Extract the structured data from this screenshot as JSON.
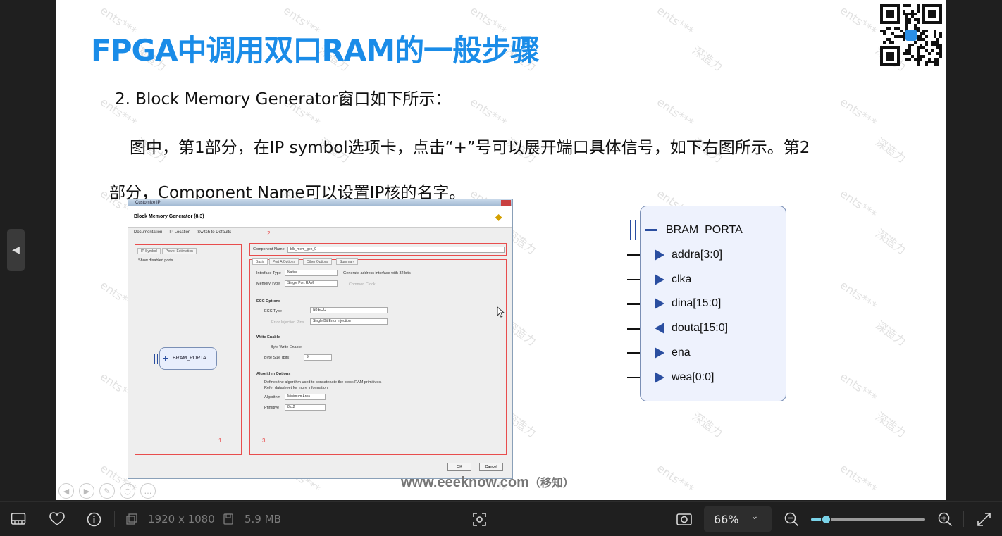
{
  "slide": {
    "title": "FPGA中调用双口RAM的一般步骤",
    "line1": "2.  Block Memory Generator窗口如下所示：",
    "line2": "图中，第1部分，在IP symbol选项卡，点击“+”号可以展开端口具体信号，如下右图所示。第2",
    "line3": "部分，Component Name可以设置IP核的名字。",
    "footer_url": "www.eeeknow.com",
    "footer_cn": "（移知）",
    "watermark_a": "ents***",
    "watermark_b": "深造力"
  },
  "ip_window": {
    "titlebar": "Customize IP",
    "header": "Block Memory Generator (8.3)",
    "toolbar": [
      "Documentation",
      "IP Location",
      "Switch to Defaults"
    ],
    "left_tabs": [
      "IP Symbol",
      "Power Estimation"
    ],
    "show_disabled": "Show disabled ports",
    "port_label": "BRAM_PORTA",
    "component_name_label": "Component Name",
    "component_name_value": "blk_mem_gen_0",
    "right_tabs": [
      "Basic",
      "Port A Options",
      "Other Options",
      "Summary"
    ],
    "interface_type_label": "Interface Type",
    "interface_type_value": "Native",
    "generate_addr": "Generate address interface with 32 bits",
    "memory_type_label": "Memory Type",
    "memory_type_value": "Single Port RAM",
    "common_clock": "Common Clock",
    "ecc_section": "ECC Options",
    "ecc_type_label": "ECC Type",
    "ecc_type_value": "No ECC",
    "error_injection_label": "Error Injection Pins",
    "error_injection_value": "Single Bit Error Injection",
    "write_enable_section": "Write Enable",
    "byte_write_enable": "Byte Write Enable",
    "byte_size_label": "Byte Size (bits)",
    "byte_size_value": "9",
    "algorithm_section": "Algorithm Options",
    "algorithm_desc1": "Defines the algorithm used to concatenate the block RAM primitives.",
    "algorithm_desc2": "Refer datasheet for more information.",
    "algorithm_label": "Algorithm",
    "algorithm_value": "Minimum Area",
    "primitive_label": "Primitive",
    "primitive_value": "8kx2",
    "ok": "OK",
    "cancel": "Cancel",
    "markers": [
      "1",
      "2",
      "3"
    ]
  },
  "bram": {
    "title": "BRAM_PORTA",
    "ports": [
      {
        "name": "addra[3:0]",
        "dir": "in"
      },
      {
        "name": "clka",
        "dir": "in"
      },
      {
        "name": "dina[15:0]",
        "dir": "in"
      },
      {
        "name": "douta[15:0]",
        "dir": "out"
      },
      {
        "name": "ena",
        "dir": "in"
      },
      {
        "name": "wea[0:0]",
        "dir": "in"
      }
    ]
  },
  "viewer": {
    "dimensions": "1920 x 1080",
    "filesize": "5.9 MB",
    "zoom": "66%",
    "zoom_level": 0.13,
    "colors": {
      "accent": "#7ad3e8",
      "title_blue": "#1a8ce8",
      "marker_red": "#e84d4d"
    }
  }
}
